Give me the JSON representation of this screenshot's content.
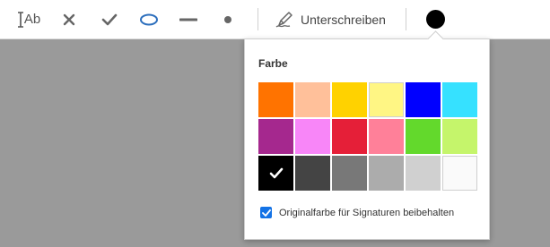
{
  "toolbar": {
    "text_tool_label": "Ab",
    "sign_label": "Unterschreiben",
    "current_color": "#000000"
  },
  "color_panel": {
    "title": "Farbe",
    "swatches": [
      {
        "color": "#ff7300",
        "selected": false
      },
      {
        "color": "#ffc09a",
        "selected": false
      },
      {
        "color": "#ffd200",
        "selected": false
      },
      {
        "color": "#fff684",
        "selected": false
      },
      {
        "color": "#0000ff",
        "selected": false
      },
      {
        "color": "#36e1ff",
        "selected": false
      },
      {
        "color": "#a5288e",
        "selected": false
      },
      {
        "color": "#f886f8",
        "selected": false
      },
      {
        "color": "#e51f38",
        "selected": false
      },
      {
        "color": "#ff8099",
        "selected": false
      },
      {
        "color": "#63d92c",
        "selected": false
      },
      {
        "color": "#c5f56b",
        "selected": false
      },
      {
        "color": "#000000",
        "selected": true
      },
      {
        "color": "#444444",
        "selected": false
      },
      {
        "color": "#787878",
        "selected": false
      },
      {
        "color": "#acacac",
        "selected": false
      },
      {
        "color": "#d0d0d0",
        "selected": false
      },
      {
        "color": "#fafafa",
        "selected": false
      }
    ],
    "keep_original_label": "Originalfarbe für Signaturen beibehalten",
    "keep_original_checked": true,
    "accent_color": "#1473e6"
  }
}
